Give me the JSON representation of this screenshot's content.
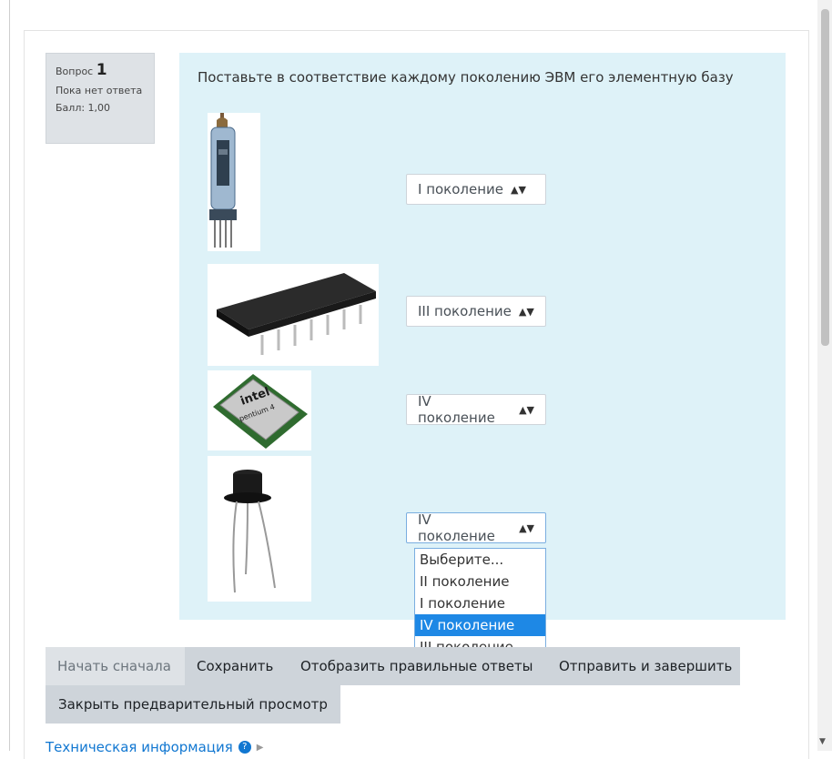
{
  "question": {
    "label": "Вопрос",
    "number": "1",
    "status": "Пока нет ответа",
    "score": "Балл: 1,00",
    "text": "Поставьте в соответствие каждому поколению ЭВМ его элементную базу"
  },
  "items": [
    {
      "image": "vacuum-tube",
      "selected": "I  поколение"
    },
    {
      "image": "integrated-circuit",
      "selected": "III поколение"
    },
    {
      "image": "microprocessor",
      "selected": "IV поколение"
    },
    {
      "image": "transistor",
      "selected": "IV поколение"
    }
  ],
  "chip_labels": {
    "intel": "intel",
    "pentium": "pentium 4"
  },
  "dropdown": {
    "options": [
      "Выберите...",
      "II поколение",
      "I  поколение",
      "IV поколение",
      "III поколение"
    ],
    "highlighted": "IV поколение"
  },
  "buttons": {
    "restart": "Начать сначала",
    "save": "Сохранить",
    "show_correct": "Отобразить правильные ответы",
    "submit": "Отправить и завершить",
    "close_preview": "Закрыть предварительный просмотр"
  },
  "tech_info": "Техническая информация"
}
